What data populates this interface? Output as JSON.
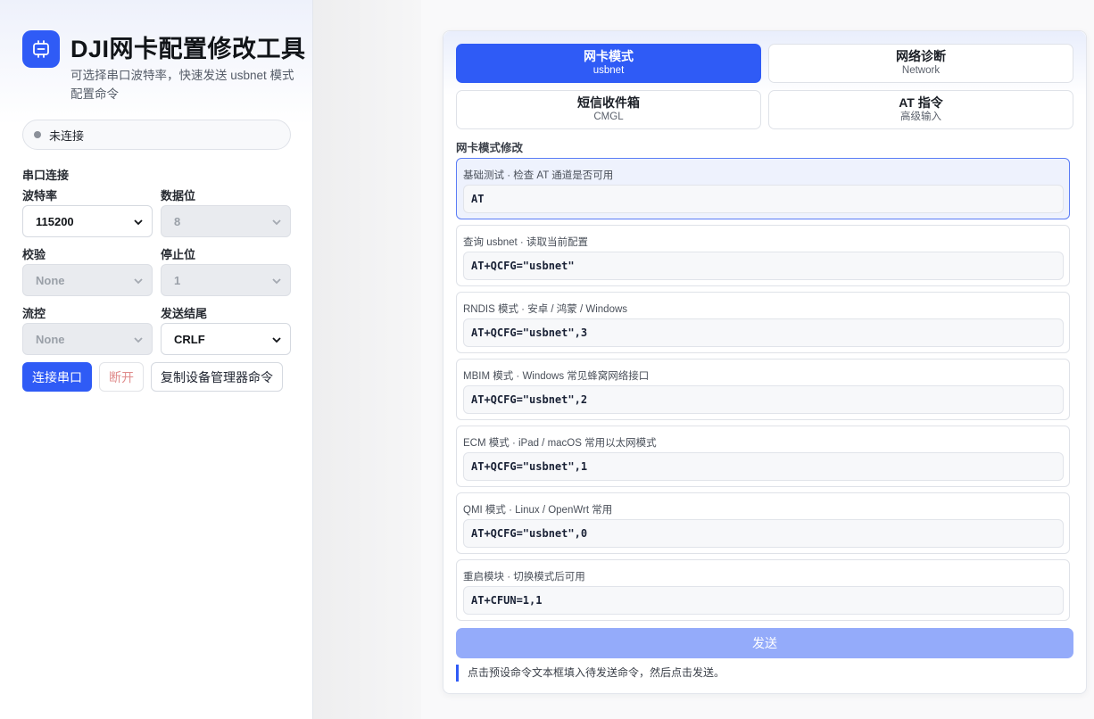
{
  "app": {
    "title": "DJI网卡配置修改工具",
    "subtitle": "可选择串口波特率，快速发送 usbnet 模式配置命令",
    "icon": "chip-icon",
    "accent": "#2f5bf6"
  },
  "status": {
    "text": "未连接",
    "dot_color": "#8b9099"
  },
  "serial": {
    "section_title": "串口连接",
    "baud": {
      "label": "波特率",
      "value": "115200"
    },
    "databits": {
      "label": "数据位",
      "value": "8"
    },
    "parity": {
      "label": "校验",
      "value": "None"
    },
    "stopbits": {
      "label": "停止位",
      "value": "1"
    },
    "flow": {
      "label": "流控",
      "value": "None"
    },
    "ending": {
      "label": "发送结尾",
      "value": "CRLF"
    },
    "buttons": {
      "connect": "连接串口",
      "disconnect": "断开",
      "copy": "复制设备管理器命令"
    }
  },
  "tabs": [
    {
      "title": "网卡模式",
      "sub": "usbnet"
    },
    {
      "title": "网络诊断",
      "sub": "Network"
    },
    {
      "title": "短信收件箱",
      "sub": "CMGL"
    },
    {
      "title": "AT 指令",
      "sub": "高级输入"
    }
  ],
  "group_title": "网卡模式修改",
  "commands": [
    {
      "desc": "基础测试 · 检查 AT 通道是否可用",
      "cmd": "AT"
    },
    {
      "desc": "查询 usbnet · 读取当前配置",
      "cmd": "AT+QCFG=\"usbnet\""
    },
    {
      "desc": "RNDIS 模式 · 安卓 / 鸿蒙 / Windows",
      "cmd": "AT+QCFG=\"usbnet\",3"
    },
    {
      "desc": "MBIM 模式 · Windows 常见蜂窝网络接口",
      "cmd": "AT+QCFG=\"usbnet\",2"
    },
    {
      "desc": "ECM 模式 · iPad / macOS 常用以太网模式",
      "cmd": "AT+QCFG=\"usbnet\",1"
    },
    {
      "desc": "QMI 模式 · Linux / OpenWrt 常用",
      "cmd": "AT+QCFG=\"usbnet\",0"
    },
    {
      "desc": "重启模块 · 切换模式后可用",
      "cmd": "AT+CFUN=1,1"
    }
  ],
  "send_label": "发送",
  "hint": "点击预设命令文本框填入待发送命令，然后点击发送。"
}
